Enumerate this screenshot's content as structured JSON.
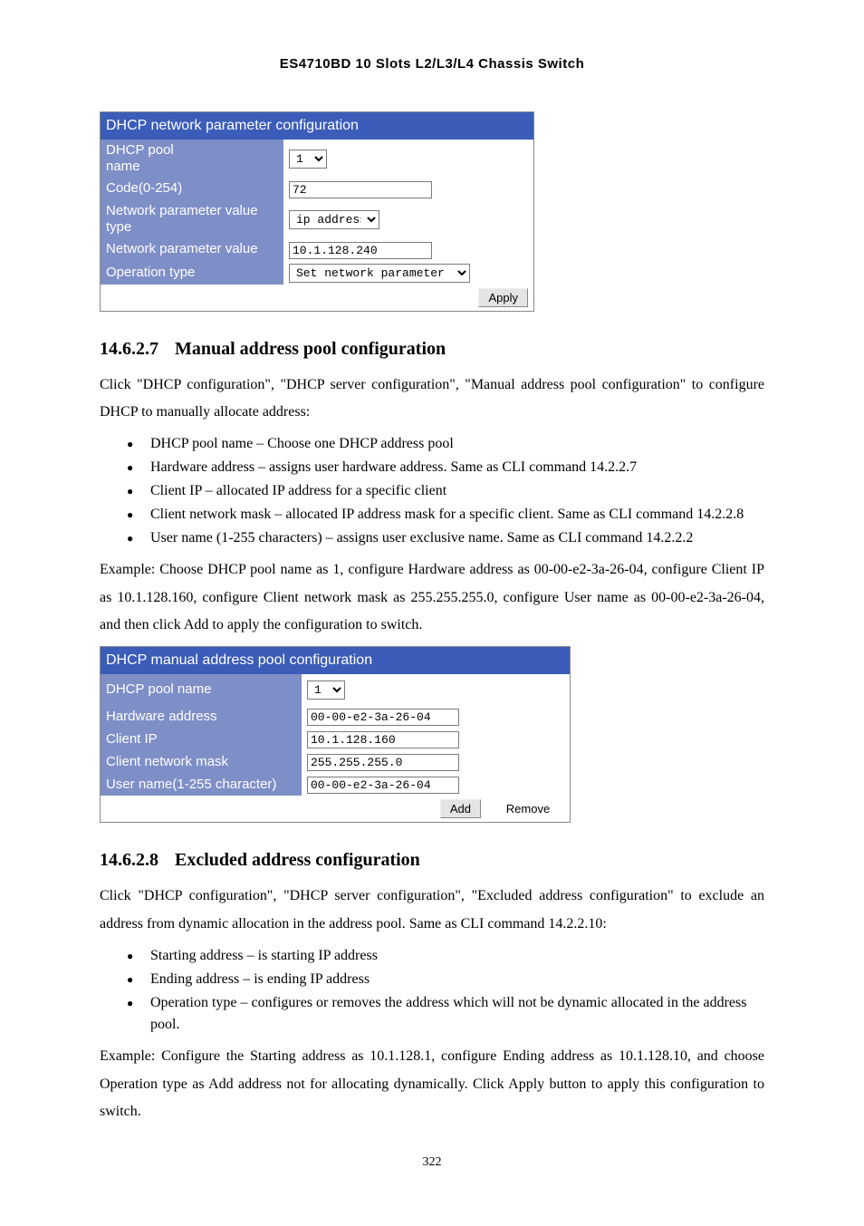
{
  "header": "ES4710BD 10 Slots L2/L3/L4 Chassis Switch",
  "form1": {
    "title": "DHCP network parameter configuration",
    "rows": {
      "pool_name_label": "DHCP pool\nname",
      "pool_name_value": "1",
      "code_label": "Code(0-254)",
      "code_value": "72",
      "value_type_label": "Network parameter value type",
      "value_type_value": "ip address",
      "value_label": "Network parameter value",
      "value_value": "10.1.128.240",
      "op_type_label": "Operation type",
      "op_type_value": "Set network parameter"
    },
    "apply": "Apply"
  },
  "section1": {
    "num": "14.6.2.7",
    "title": "Manual address pool configuration",
    "para1": "Click \"DHCP configuration\", \"DHCP server configuration\", \"Manual address pool configuration\" to configure DHCP to manually allocate address:",
    "bullets": [
      "DHCP pool name – Choose one DHCP address pool",
      "Hardware address – assigns user hardware address. Same as CLI command 14.2.2.7",
      "Client IP – allocated IP address for a specific client",
      "Client network mask – allocated IP address mask for a specific client. Same as CLI command 14.2.2.8",
      "User name (1-255 characters) – assigns user exclusive name. Same as CLI command 14.2.2.2"
    ],
    "para2": "Example: Choose DHCP pool name as 1, configure Hardware address as 00-00-e2-3a-26-04, configure Client IP as 10.1.128.160, configure Client network mask as 255.255.255.0, configure User name as 00-00-e2-3a-26-04, and then click Add to apply the configuration to switch."
  },
  "form2": {
    "title": "DHCP manual address pool configuration",
    "rows": {
      "pool_name_label": "DHCP pool name",
      "pool_name_value": "1",
      "hw_label": "Hardware address",
      "hw_value": "00-00-e2-3a-26-04",
      "clientip_label": "Client IP",
      "clientip_value": "10.1.128.160",
      "mask_label": "Client network mask",
      "mask_value": "255.255.255.0",
      "user_label": "User name(1-255 character)",
      "user_value": "00-00-e2-3a-26-04"
    },
    "add": "Add",
    "remove": "Remove"
  },
  "section2": {
    "num": "14.6.2.8",
    "title": "Excluded address configuration",
    "para1": "Click \"DHCP configuration\", \"DHCP server configuration\", \"Excluded address configuration\" to exclude an address from dynamic allocation in the address pool. Same as CLI command 14.2.2.10:",
    "bullets": [
      "Starting address – is starting IP address",
      "Ending address – is ending IP address",
      "Operation type – configures or removes the address which will not be dynamic allocated in the address pool."
    ],
    "para2": "Example: Configure the Starting address as 10.1.128.1, configure Ending address as 10.1.128.10, and choose Operation type as Add address not for allocating dynamically. Click Apply button to apply this configuration to switch."
  },
  "page_number": "322"
}
